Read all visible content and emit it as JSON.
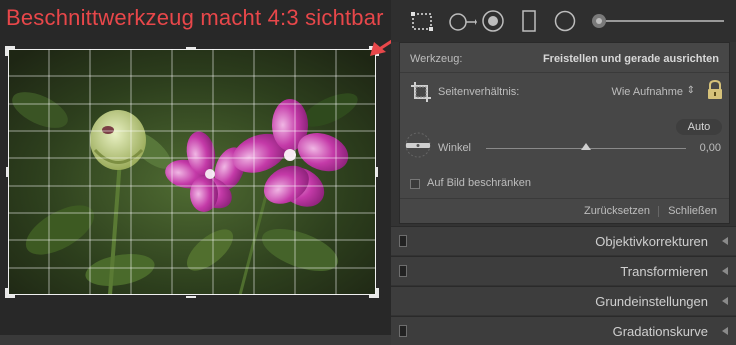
{
  "annotation": {
    "text": "Beschnittwerkzeug macht 4:3 sichtbar",
    "color": "#e8474a"
  },
  "toolstrip": {
    "tools": [
      "crop-overlay-icon",
      "spot-removal-icon",
      "red-eye-icon",
      "graduated-filter-icon",
      "radial-filter-icon",
      "adjustment-brush-icon"
    ]
  },
  "crop_panel": {
    "tool_label": "Werkzeug:",
    "tool_value": "Freistellen und gerade ausrichten",
    "aspect_label": "Seitenverhältnis:",
    "aspect_value": "Wie Aufnahme",
    "auto_label": "Auto",
    "angle_label": "Winkel",
    "angle_value": "0,00",
    "constrain_label": "Auf Bild beschränken",
    "reset_label": "Zurücksetzen",
    "close_label": "Schließen"
  },
  "sections": [
    {
      "title": "Objektivkorrekturen"
    },
    {
      "title": "Transformieren"
    },
    {
      "title": "Grundeinstellungen"
    },
    {
      "title": "Gradationskurve"
    }
  ],
  "colors": {
    "panel_bg": "#333333",
    "accent_red": "#e8474a",
    "flower": "#b8359c"
  }
}
